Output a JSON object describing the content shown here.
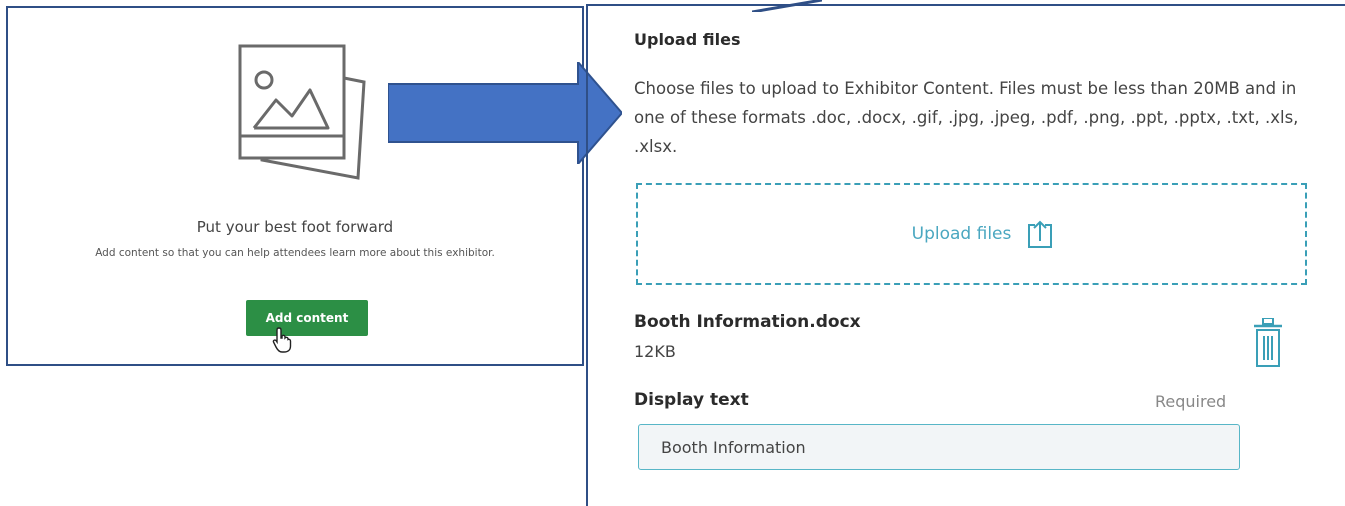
{
  "empty_state": {
    "title": "Put your best foot forward",
    "description": "Add content so that you can help attendees learn more about this exhibitor.",
    "add_button_label": "Add content"
  },
  "upload": {
    "title": "Upload files",
    "description": "Choose files to upload to Exhibitor Content. Files must be less than 20MB and in one of these formats .doc, .docx, .gif, .jpg, .jpeg, .pdf, .png, .ppt, .pptx, .txt, .xls, .xlsx.",
    "dropzone_label": "Upload files"
  },
  "file": {
    "name": "Booth Information.docx",
    "size": "12KB"
  },
  "display_text": {
    "label": "Display text",
    "required_label": "Required",
    "value": "Booth Information"
  },
  "colors": {
    "arrow": "#4472c4",
    "frame": "#2f4f86",
    "button": "#2c8f45",
    "accent": "#3a9fb7"
  },
  "icons": [
    "image-placeholder-icon",
    "pointer-cursor-icon",
    "upload-icon",
    "trash-icon"
  ]
}
